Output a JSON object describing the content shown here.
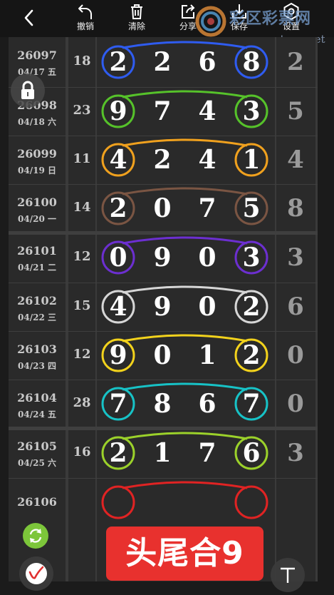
{
  "toolbar": {
    "undo_label": "撤销",
    "clear_label": "清除",
    "share_label": "分享",
    "save_label": "保存",
    "settings_label": "设置"
  },
  "watermark": {
    "title": "彩区彩票网",
    "url": "www.tqcp.net"
  },
  "rows": [
    {
      "issue": "26097",
      "date": "04/17 五",
      "sum": "18",
      "digits": [
        "2",
        "2",
        "6",
        "8"
      ],
      "tail": "2",
      "color": "#2f5cf0"
    },
    {
      "issue": "26098",
      "date": "04/18 六",
      "sum": "23",
      "digits": [
        "9",
        "7",
        "4",
        "3"
      ],
      "tail": "5",
      "color": "#56c22a"
    },
    {
      "issue": "26099",
      "date": "04/19 日",
      "sum": "11",
      "digits": [
        "4",
        "2",
        "4",
        "1"
      ],
      "tail": "4",
      "color": "#f0a11e"
    },
    {
      "issue": "26100",
      "date": "04/20 一",
      "sum": "14",
      "digits": [
        "2",
        "0",
        "7",
        "5"
      ],
      "tail": "8",
      "color": "#7a5543"
    },
    {
      "issue": "26101",
      "date": "04/21 二",
      "sum": "12",
      "digits": [
        "0",
        "9",
        "0",
        "3"
      ],
      "tail": "3",
      "color": "#6c2fd0"
    },
    {
      "issue": "26102",
      "date": "04/22 三",
      "sum": "15",
      "digits": [
        "4",
        "9",
        "0",
        "2"
      ],
      "tail": "6",
      "color": "#d6d6d6"
    },
    {
      "issue": "26103",
      "date": "04/23 四",
      "sum": "12",
      "digits": [
        "9",
        "0",
        "1",
        "2"
      ],
      "tail": "0",
      "color": "#f2d21c"
    },
    {
      "issue": "26104",
      "date": "04/24 五",
      "sum": "28",
      "digits": [
        "7",
        "8",
        "6",
        "7"
      ],
      "tail": "0",
      "color": "#17c2c6"
    },
    {
      "issue": "26105",
      "date": "04/25 六",
      "sum": "16",
      "digits": [
        "2",
        "1",
        "7",
        "6"
      ],
      "tail": "3",
      "color": "#9bd12a"
    },
    {
      "issue": "26106",
      "date": "",
      "sum": "",
      "digits": [
        "",
        "",
        "",
        ""
      ],
      "tail": "",
      "color": "#e02323"
    }
  ],
  "banner": {
    "text": "头尾合9"
  },
  "icons": {
    "back": "chevron-left-icon",
    "undo": "undo-icon",
    "clear": "trash-icon",
    "share": "share-icon",
    "save": "download-icon",
    "settings": "settings-icon",
    "lock": "lock-icon",
    "refresh": "refresh-icon",
    "pen": "pen-icon",
    "text": "text-tool-icon"
  },
  "colors": {
    "banner": "#e8312e",
    "refresh": "#7cc63a",
    "background": "#2a2a2a"
  }
}
